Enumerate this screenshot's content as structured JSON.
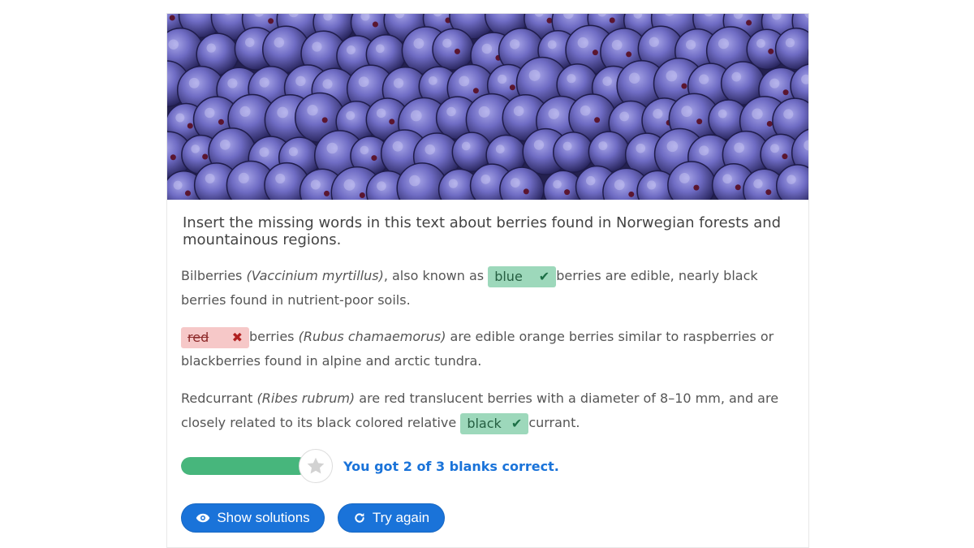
{
  "question": "Insert the missing words in this text about berries found in Norwegian forests and mountainous regions.",
  "paragraphs": [
    {
      "pre": "Bilberries ",
      "latin": "(Vaccinium myrtillus)",
      "mid": ", also known as ",
      "blank": {
        "value": "blue",
        "status": "correct",
        "mark_icon": "checkmark-icon"
      },
      "post": "berries are edible, nearly black berries found in nutrient-poor soils."
    },
    {
      "blank": {
        "value": "red",
        "status": "wrong",
        "mark_icon": "x-mark-icon"
      },
      "mid": "berries ",
      "latin": "(Rubus chamaemorus)",
      "post": " are edible orange berries similar to raspberries or blackberries found in alpine and arctic tundra."
    },
    {
      "pre": "Redcurrant ",
      "latin": "(Ribes rubrum)",
      "mid": " are red translucent berries with a diameter of 8–10 mm, and are closely related to its black colored relative ",
      "blank": {
        "value": "black",
        "status": "correct",
        "mark_icon": "checkmark-icon"
      },
      "post": "currant."
    }
  ],
  "score": {
    "text": "You got 2 of 3 blanks correct.",
    "correct": 2,
    "total": 3,
    "progress_fraction": 1.0
  },
  "buttons": {
    "show_solutions": "Show solutions",
    "try_again": "Try again"
  },
  "colors": {
    "accent": "#1a73d9",
    "progress": "#47b67c",
    "correct_bg": "#9dd8bb",
    "wrong_bg": "#f6c8c8"
  }
}
